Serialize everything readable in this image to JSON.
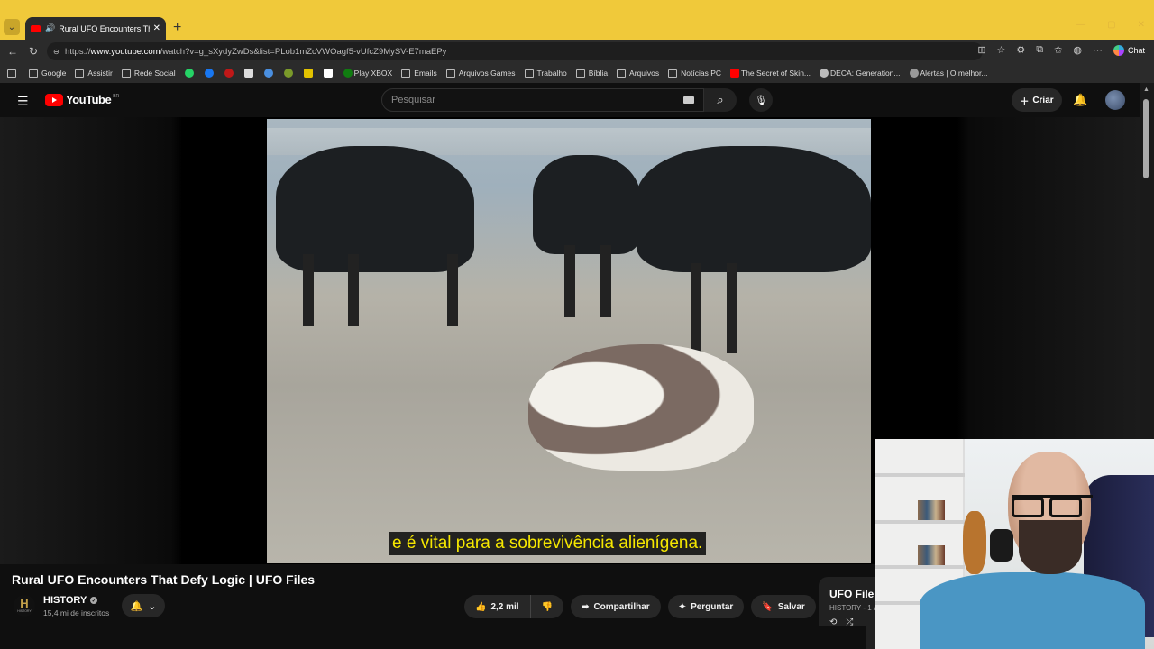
{
  "browser": {
    "tab_title": "Rural UFO Encounters That Defy",
    "url_prefix": "https://",
    "url_host": "www.youtube.com",
    "url_path": "/watch?v=g_sXydyZwDs&list=PLob1mZcVWOagf5-vUfcZ9MySV-E7maEPy",
    "chat_label": "Chat",
    "new_tab": "+",
    "bookmarks": [
      "Google",
      "Assistir",
      "Rede Social",
      "Play XBOX",
      "Emails",
      "Arquivos Games",
      "Trabalho",
      "Bíblia",
      "Arquivos",
      "Notícias PC",
      "The Secret of Skin...",
      "DECA: Generation...",
      "Alertas | O melhor..."
    ]
  },
  "youtube": {
    "logo_text": "YouTube",
    "region": "BR",
    "search_placeholder": "Pesquisar",
    "create_label": "Criar"
  },
  "video": {
    "subtitle": "e é vital para a sobrevivência alienígena.",
    "title": "Rural UFO Encounters That Defy Logic | UFO Files",
    "channel_name": "HISTORY",
    "channel_logo_letter": "H",
    "channel_logo_sub": "HISTORY",
    "subscribers": "15,4 mi de inscritos",
    "likes": "2,2 mil",
    "share_label": "Compartilhar",
    "ask_label": "Perguntar",
    "save_label": "Salvar"
  },
  "playlist": {
    "title": "UFO File",
    "subtitle": "HISTORY - 1 /"
  },
  "colors": {
    "tabbar": "#f0c93a",
    "youtube_red": "#ff0000",
    "subtitle_text": "#f5e700"
  }
}
